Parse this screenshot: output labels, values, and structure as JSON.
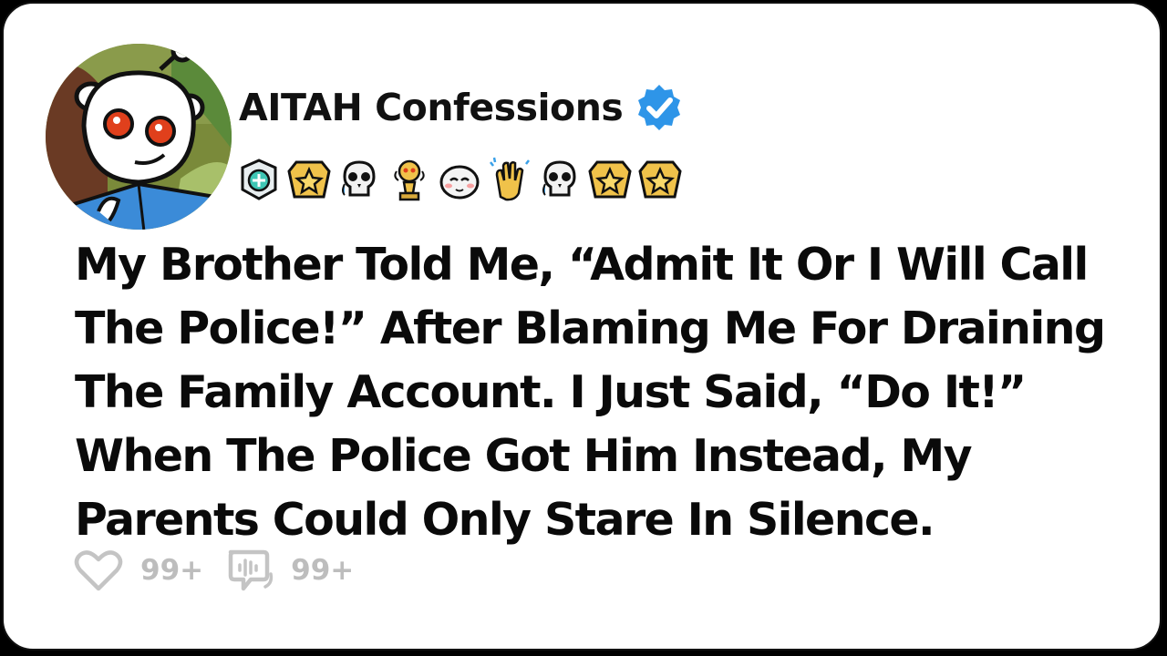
{
  "post": {
    "channel_name": "AITAH Confessions",
    "title": "My Brother Told Me, “Admit It Or I Will Call The Police!” After Blaming Me For Draining The Family Account. I Just Said, “Do It!” When The Police Got Him Instead, My Parents Could Only Stare In Silence."
  },
  "badges": [
    {
      "icon": "helpful-award-icon"
    },
    {
      "icon": "gold-star-award-icon"
    },
    {
      "icon": "crying-skull-award-icon"
    },
    {
      "icon": "trophy-snoo-award-icon"
    },
    {
      "icon": "blushing-face-award-icon"
    },
    {
      "icon": "clapping-hands-award-icon"
    },
    {
      "icon": "crying-skull-award-icon"
    },
    {
      "icon": "gold-star-award-icon"
    },
    {
      "icon": "gold-star-award-icon"
    }
  ],
  "stats": {
    "likes": "99+",
    "comments": "99+"
  },
  "colors": {
    "verified_badge": "#2e95e8",
    "award_gold": "#f0c24a",
    "snoo_eye": "#e0401c",
    "avatar_book": "#3b8bd8",
    "stat_gray": "#bdbdbd"
  }
}
